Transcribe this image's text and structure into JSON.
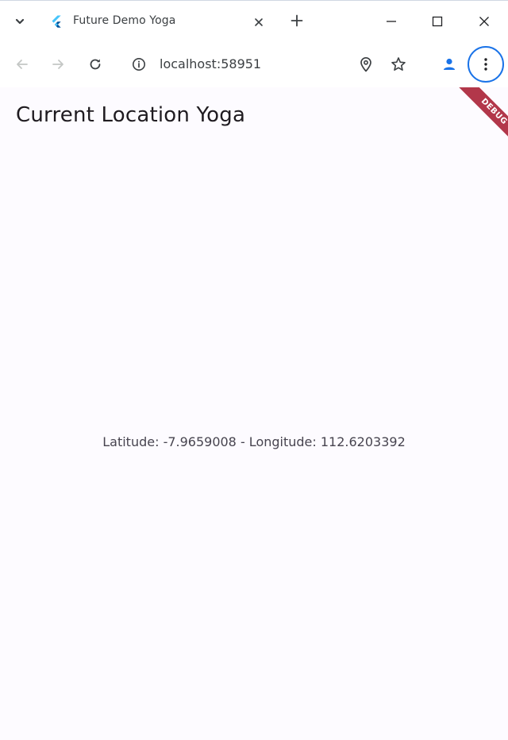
{
  "browser": {
    "tab": {
      "title": "Future Demo Yoga",
      "favicon": "flutter-logo-icon"
    },
    "omnibox": {
      "url": "localhost:58951"
    },
    "accent_color": "#1a73e8"
  },
  "app": {
    "title": "Current Location Yoga",
    "location_text": "Latitude: -7.9659008 - Longitude: 112.6203392",
    "debug_banner": "DEBUG",
    "debug_color": "#b2374a",
    "background": "#fdfbff"
  }
}
